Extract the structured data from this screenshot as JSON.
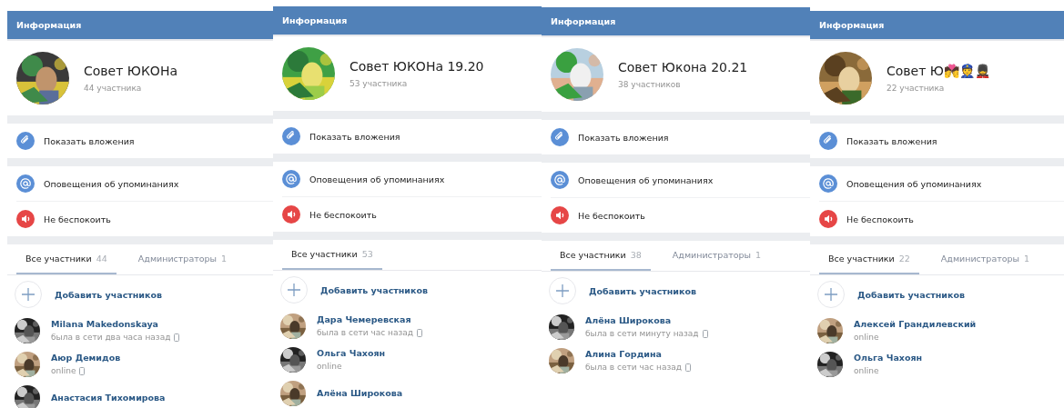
{
  "panels": [
    {
      "header": "Информация",
      "chat": {
        "title": "Совет ЮКОНа",
        "members": "44 участника"
      },
      "actions": [
        {
          "kind": "attachments",
          "label": "Показать вложения"
        },
        {
          "kind": "mentions",
          "label": "Оповещения об упоминаниях"
        },
        {
          "kind": "mute",
          "label": "Не беспокоить"
        }
      ],
      "tabs": [
        {
          "label": "Все участники",
          "count": "44",
          "selected": true
        },
        {
          "label": "Администраторы",
          "count": "1",
          "selected": false
        }
      ],
      "add_button": "Добавить участников",
      "members": [
        {
          "name": "Milana Makedonskaya",
          "status": "была в сети два часа назад",
          "mobile": true
        },
        {
          "name": "Аюр Демидов",
          "status": "online",
          "mobile": true
        },
        {
          "name": "Анастасия Тихомирова"
        }
      ]
    },
    {
      "header": "Информация",
      "chat": {
        "title": "Совет ЮКОНа 19.20",
        "members": "53 участника"
      },
      "actions": [
        {
          "kind": "attachments",
          "label": "Показать вложения"
        },
        {
          "kind": "mentions",
          "label": "Оповещения об упоминаниях"
        },
        {
          "kind": "mute",
          "label": "Не беспокоить"
        }
      ],
      "tabs": [
        {
          "label": "Все участники",
          "count": "53",
          "selected": true
        }
      ],
      "add_button": "Добавить участников",
      "members": [
        {
          "name": "Дара Чемеревская",
          "status": "была в сети час назад",
          "mobile": true
        },
        {
          "name": "Ольга Чахоян",
          "status": "online",
          "mobile": false
        },
        {
          "name": "Алёна Широкова"
        }
      ]
    },
    {
      "header": "Информация",
      "chat": {
        "title": "Совет Юкона 20.21",
        "members": "38 участников"
      },
      "actions": [
        {
          "kind": "attachments",
          "label": "Показать вложения"
        },
        {
          "kind": "mentions",
          "label": "Оповещения об упоминаниях"
        },
        {
          "kind": "mute",
          "label": "Не беспокоить"
        }
      ],
      "tabs": [
        {
          "label": "Все участники",
          "count": "38",
          "selected": true
        },
        {
          "label": "Администраторы",
          "count": "1",
          "selected": false
        }
      ],
      "add_button": "Добавить участников",
      "members": [
        {
          "name": "Алёна Широкова",
          "status": "была в сети минуту назад",
          "mobile": true
        },
        {
          "name": "Алина Гордина",
          "status": "была в сети час назад",
          "mobile": true
        }
      ]
    },
    {
      "header": "Информация",
      "chat": {
        "title": "Совет Ю💏👮💂",
        "members": "22 участника"
      },
      "actions": [
        {
          "kind": "attachments",
          "label": "Показать вложения"
        },
        {
          "kind": "mentions",
          "label": "Оповещения об упоминаниях"
        },
        {
          "kind": "mute",
          "label": "Не беспокоить"
        }
      ],
      "tabs": [
        {
          "label": "Все участники",
          "count": "22",
          "selected": true
        },
        {
          "label": "Администраторы",
          "count": "1",
          "selected": false
        }
      ],
      "add_button": "Добавить участников",
      "members": [
        {
          "name": "Алексей Грандилевский",
          "status": "online",
          "mobile": false
        },
        {
          "name": "Ольга Чахоян",
          "status": "online",
          "mobile": false
        }
      ]
    }
  ]
}
